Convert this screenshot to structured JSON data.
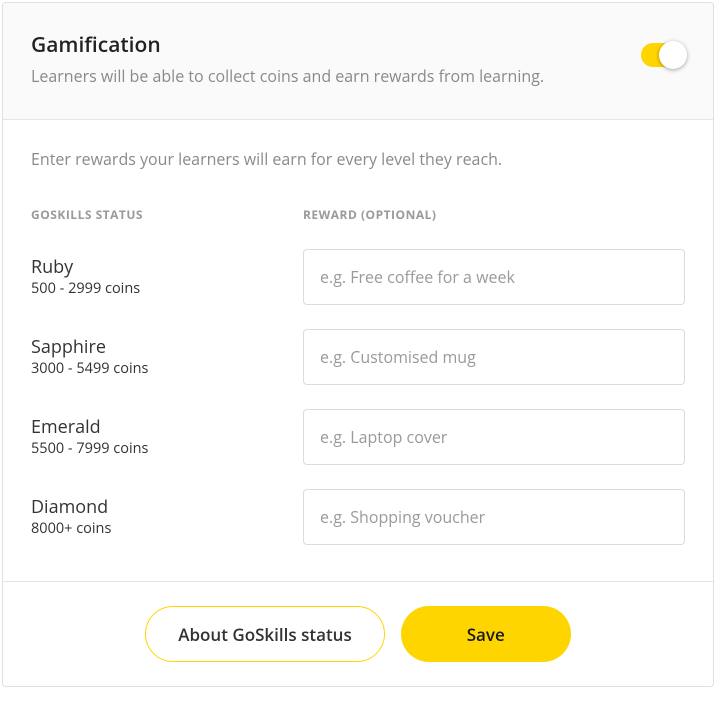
{
  "header": {
    "title": "Gamification",
    "subtitle": "Learners will be able to collect coins and earn rewards from learning."
  },
  "body": {
    "description": "Enter rewards your learners will earn for every level they reach.",
    "status_header": "GOSKILLS STATUS",
    "reward_header": "REWARD (OPTIONAL)",
    "levels": [
      {
        "name": "Ruby",
        "range": "500 - 2999 coins",
        "placeholder": "e.g. Free coffee for a week"
      },
      {
        "name": "Sapphire",
        "range": "3000 - 5499 coins",
        "placeholder": "e.g. Customised mug"
      },
      {
        "name": "Emerald",
        "range": "5500 - 7999 coins",
        "placeholder": "e.g. Laptop cover"
      },
      {
        "name": "Diamond",
        "range": "8000+ coins",
        "placeholder": "e.g. Shopping voucher"
      }
    ]
  },
  "footer": {
    "about_label": "About GoSkills status",
    "save_label": "Save"
  }
}
